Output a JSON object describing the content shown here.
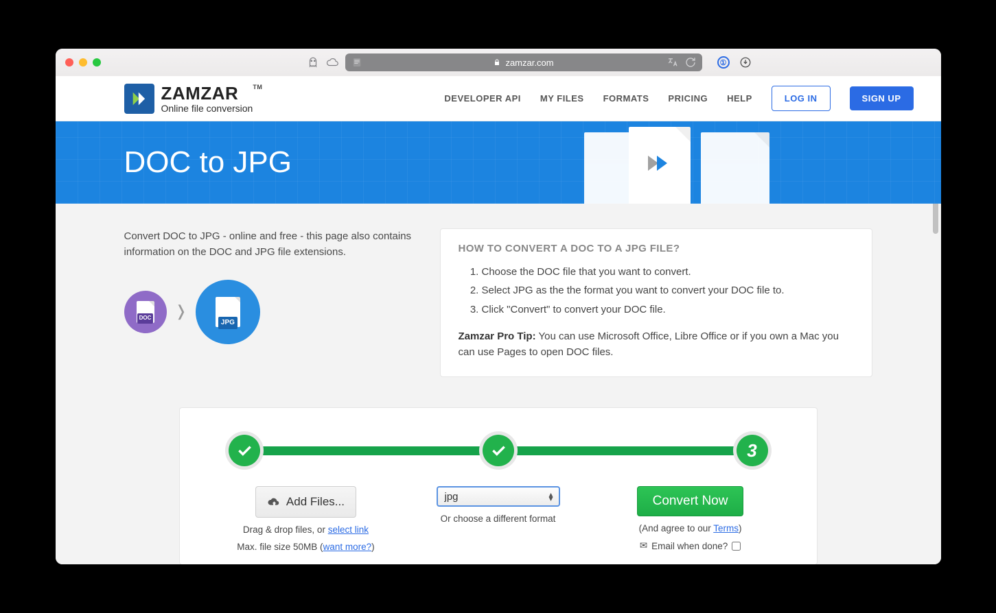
{
  "browser": {
    "domain": "zamzar.com"
  },
  "brand": {
    "name": "ZAMZAR",
    "tm": "TM",
    "tagline": "Online file conversion"
  },
  "nav": {
    "api": "DEVELOPER API",
    "myfiles": "MY FILES",
    "formats": "FORMATS",
    "pricing": "PRICING",
    "help": "HELP",
    "login": "LOG IN",
    "signup": "SIGN UP"
  },
  "hero": {
    "title": "DOC to JPG"
  },
  "intro": {
    "text": "Convert DOC to JPG - online and free - this page also contains information on the DOC and JPG file extensions.",
    "doc_label": "DOC",
    "jpg_label": "JPG"
  },
  "howto": {
    "title": "HOW TO CONVERT A DOC TO A JPG FILE?",
    "step1": "Choose the DOC file that you want to convert.",
    "step2": "Select JPG as the the format you want to convert your DOC file to.",
    "step3": "Click \"Convert\" to convert your DOC file.",
    "tip_label": "Zamzar Pro Tip:",
    "tip_text": " You can use Microsoft Office, Libre Office or if you own a Mac you can use Pages to open DOC files."
  },
  "steps": {
    "node3": "3",
    "add_files": "Add Files...",
    "drag_drop_prefix": "Drag & drop files, or ",
    "drag_drop_link": "select link",
    "max_prefix": "Max. file size 50MB (",
    "max_link": "want more?",
    "max_suffix": ")",
    "format_value": "jpg",
    "format_hint": "Or choose a different format",
    "convert": "Convert Now",
    "agree_prefix": "(And agree to our ",
    "agree_link": "Terms",
    "agree_suffix": ")",
    "email_label": "Email when done?"
  }
}
